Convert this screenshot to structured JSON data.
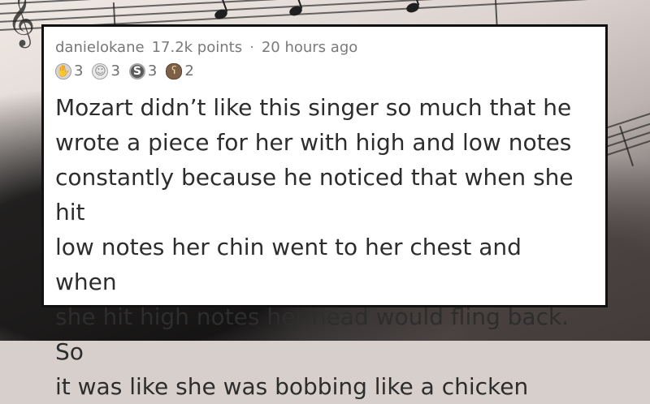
{
  "comment": {
    "username": "danielokane",
    "points": "17.2k points",
    "separator": "·",
    "timestamp": "20 hours ago",
    "awards": [
      {
        "icon": "hand-icon",
        "count": "3"
      },
      {
        "icon": "face-icon",
        "count": "3"
      },
      {
        "icon": "silver-icon",
        "count": "3"
      },
      {
        "icon": "bear-icon",
        "count": "2"
      }
    ],
    "body_lines": [
      "Mozart didn’t like this singer so much that he",
      "wrote a piece for her with high and low notes",
      "constantly because he noticed that when she hit",
      "low notes her chin went to her chest and when",
      "she hit high notes her head would fling back. So",
      "it was like she was bobbing like a chicken"
    ]
  },
  "theme": {
    "card_background": "#ffffff",
    "card_border": "#111111",
    "meta_text": "#777777",
    "body_text": "#2d2d2d"
  }
}
